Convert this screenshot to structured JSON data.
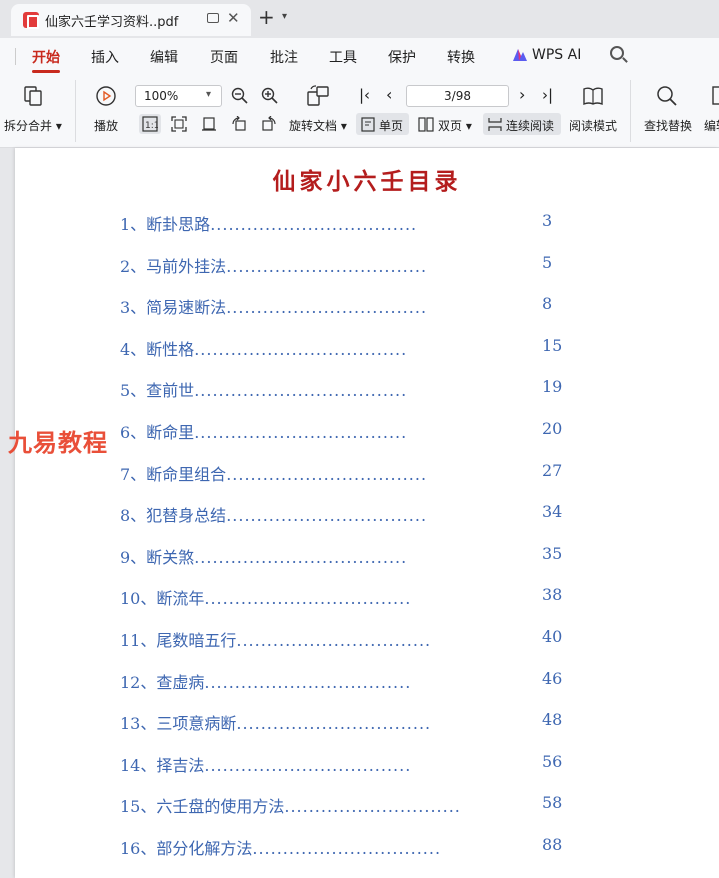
{
  "tab": {
    "title": "仙家六壬学习资料..pdf"
  },
  "menu": {
    "items": [
      "开始",
      "插入",
      "编辑",
      "页面",
      "批注",
      "工具",
      "保护",
      "转换",
      "WPS AI"
    ]
  },
  "toolbar": {
    "split_merge": "拆分合并",
    "play": "播放",
    "zoom": "100%",
    "rotate_doc": "旋转文档",
    "page_indicator": "3/98",
    "single_page": "单页",
    "double_page": "双页",
    "continuous_read": "连续阅读",
    "read_mode": "阅读模式",
    "find_replace": "查找替换",
    "edit": "编辑"
  },
  "document": {
    "title": "仙家小六壬目录",
    "toc": [
      {
        "label": "1、断卦思路",
        "dots": "..................................",
        "page": "3"
      },
      {
        "label": "2、马前外挂法",
        "dots": ".................................",
        "page": "5"
      },
      {
        "label": "3、简易速断法",
        "dots": ".................................",
        "page": "8"
      },
      {
        "label": "4、断性格",
        "dots": "...................................",
        "page": "15"
      },
      {
        "label": "5、查前世",
        "dots": "...................................",
        "page": "19"
      },
      {
        "label": "6、断命里",
        "dots": "...................................",
        "page": "20"
      },
      {
        "label": "7、断命里组合",
        "dots": ".................................",
        "page": "27"
      },
      {
        "label": "8、犯替身总结",
        "dots": ".................................",
        "page": "34"
      },
      {
        "label": "9、断关煞",
        "dots": "...................................",
        "page": "35"
      },
      {
        "label": "10、断流年",
        "dots": "..................................",
        "page": "38"
      },
      {
        "label": "11、尾数暗五行",
        "dots": "................................",
        "page": "40"
      },
      {
        "label": "12、查虚病",
        "dots": "..................................",
        "page": "46"
      },
      {
        "label": "13、三项意病断",
        "dots": "................................",
        "page": "48"
      },
      {
        "label": "14、择吉法",
        "dots": "..................................",
        "page": "56"
      },
      {
        "label": "15、六壬盘的使用方法",
        "dots": ".............................",
        "page": "58"
      },
      {
        "label": "16、部分化解方法",
        "dots": "...............................",
        "page": "88"
      }
    ]
  },
  "watermark": "九易教程",
  "colors": {
    "accent": "#c82a1e",
    "title": "#b41d1d",
    "toc": "#3e67b1",
    "watermark": "#e8462f"
  }
}
